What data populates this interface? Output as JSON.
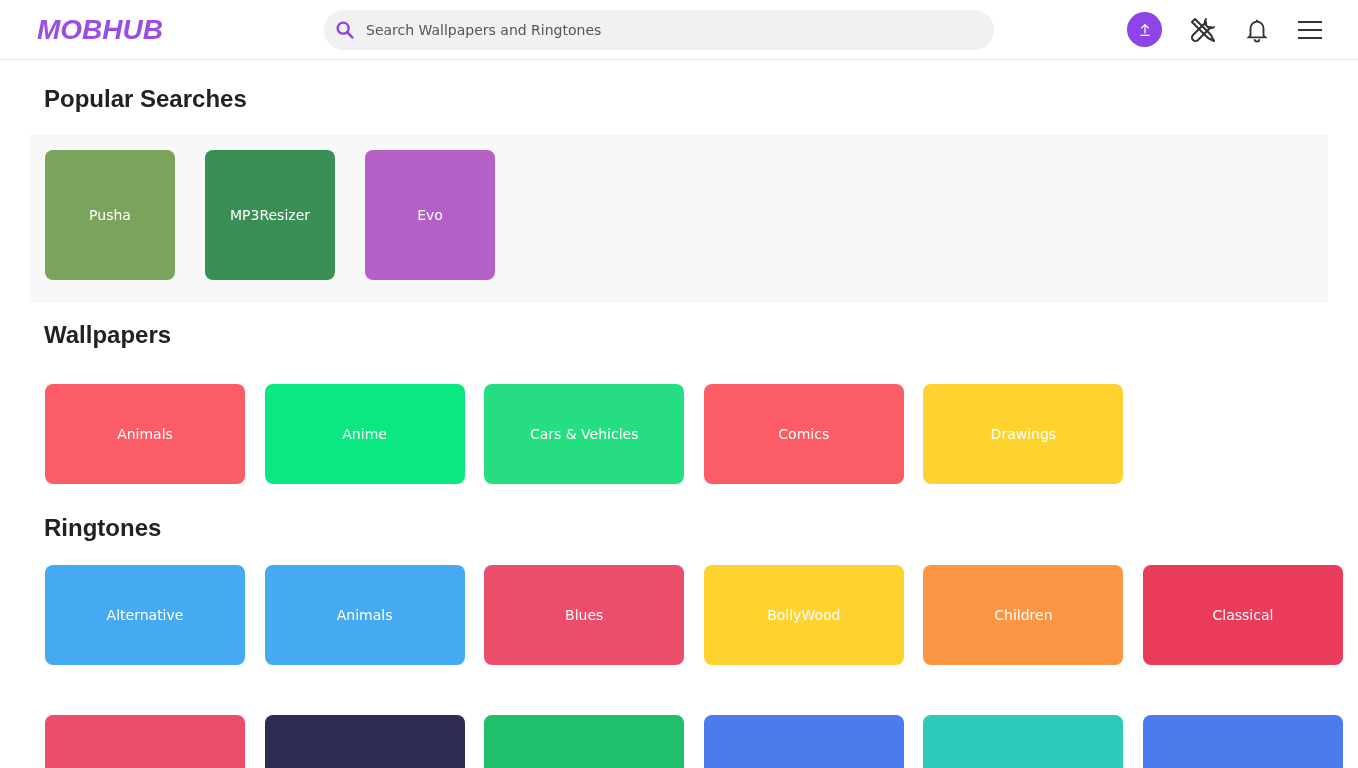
{
  "header": {
    "logo": "MOBHUB",
    "search": {
      "placeholder": "Search Wallpapers and Ringtones"
    }
  },
  "popular_searches": {
    "title": "Popular Searches",
    "items": [
      {
        "label": "Pusha",
        "color": "#7aa35c"
      },
      {
        "label": "MP3Resizer",
        "color": "#3a8f55"
      },
      {
        "label": "Evo",
        "color": "#b460c6"
      }
    ]
  },
  "wallpapers": {
    "title": "Wallpapers",
    "items": [
      {
        "label": "Animals",
        "color": "#fc5c65"
      },
      {
        "label": "Anime",
        "color": "#0be881"
      },
      {
        "label": "Cars & Vehicles",
        "color": "#26de81"
      },
      {
        "label": "Comics",
        "color": "#fc5c65"
      },
      {
        "label": "Drawings",
        "color": "#fed330"
      }
    ]
  },
  "ringtones": {
    "title": "Ringtones",
    "items": [
      {
        "label": "Alternative",
        "color": "#45aaf2"
      },
      {
        "label": "Animals",
        "color": "#45aaf2"
      },
      {
        "label": "Blues",
        "color": "#eb4d6b"
      },
      {
        "label": "BollyWood",
        "color": "#fed330"
      },
      {
        "label": "Children",
        "color": "#fd9644"
      },
      {
        "label": "Classical",
        "color": "#eb3b5a"
      },
      {
        "color": "#eb4d6b"
      },
      {
        "color": "#2c2c54"
      },
      {
        "color": "#20bf6b"
      },
      {
        "color": "#4b7bec"
      },
      {
        "color": "#2bcbba"
      },
      {
        "color": "#4b7bec"
      }
    ]
  }
}
